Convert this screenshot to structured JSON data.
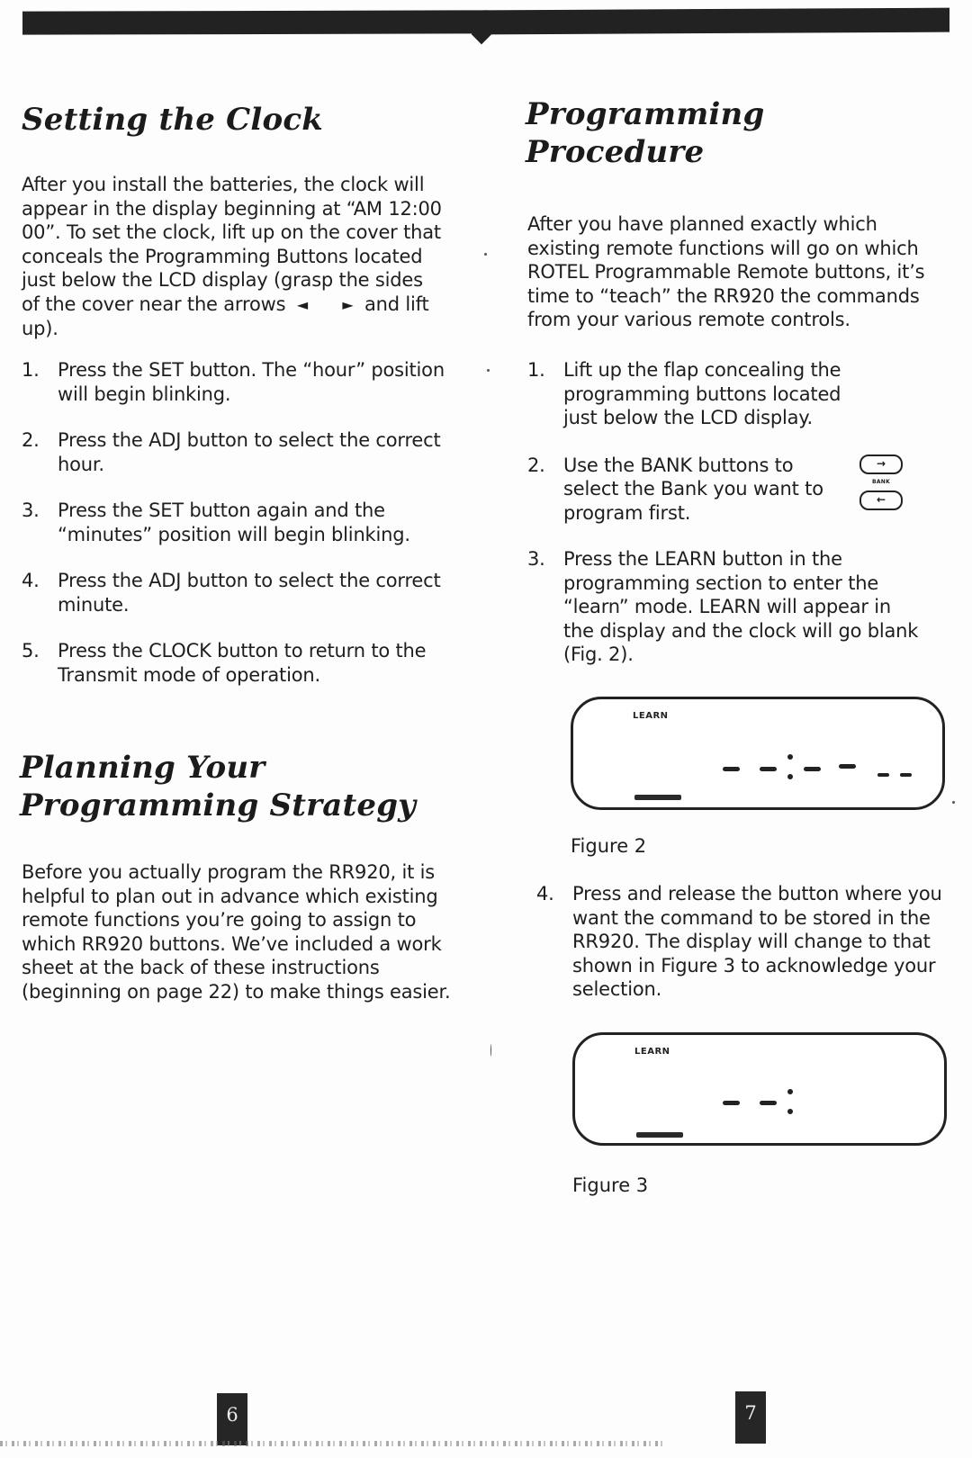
{
  "left_page": {
    "heading_1": "Setting the Clock",
    "intro_before_arrows": "After you install the batteries, the clock will appear in the display beginning at “AM 12:00 00”.  To set the clock, lift up on the cover that conceals the Programming Buttons located just below the LCD display (grasp the sides of the cover near the arrows",
    "arrow_left_glyph": "◄",
    "arrow_right_glyph": "►",
    "intro_after_arrows": "and lift up).",
    "clock_steps": [
      {
        "num": "1.",
        "text": "Press the SET button.  The “hour” position will begin blinking."
      },
      {
        "num": "2.",
        "text": "Press the ADJ button to select the correct hour."
      },
      {
        "num": "3.",
        "text": "Press the SET button again and the “minutes” position will begin blinking."
      },
      {
        "num": "4.",
        "text": "Press the ADJ button to select the correct minute."
      },
      {
        "num": "5.",
        "text": "Press the CLOCK button to return to the Transmit mode of operation."
      }
    ],
    "heading_2_line1": "Planning Your",
    "heading_2_line2": "Programming Strategy",
    "planning_text": "Before you actually program the RR920, it is helpful to plan out in advance which existing remote functions you’re going to assign to which RR920 buttons.  We’ve included a work sheet at the back of these instructions (beginning on page 22) to make things easier.",
    "page_number": "6"
  },
  "right_page": {
    "heading_line1": "Programming",
    "heading_line2": "Procedure",
    "intro": "After you have planned exactly which existing remote functions will go on which ROTEL Programmable Remote buttons, it’s time to “teach” the RR920 the commands from your various remote controls.",
    "steps": [
      {
        "num": "1.",
        "text": "Lift up the flap concealing the programming buttons located just below the LCD display."
      },
      {
        "num": "2.",
        "text": "Use the BANK buttons to select the Bank you want to program first."
      },
      {
        "num": "3.",
        "text": "Press the LEARN button in the programming section to enter the “learn” mode.  LEARN will appear in the display and the clock will go blank (Fig. 2)."
      },
      {
        "num": "4.",
        "text": "Press and release the button where you want the command to be stored in the RR920.  The display will change to that shown in Figure 3 to acknowledge your selection."
      }
    ],
    "bank_icon": {
      "up_glyph": "→",
      "label": "BANK",
      "down_glyph": "←"
    },
    "figure2": {
      "lcd_label": "LEARN",
      "caption": "Figure 2"
    },
    "figure3": {
      "lcd_label": "LEARN",
      "caption": "Figure 3"
    },
    "page_number": "7"
  }
}
